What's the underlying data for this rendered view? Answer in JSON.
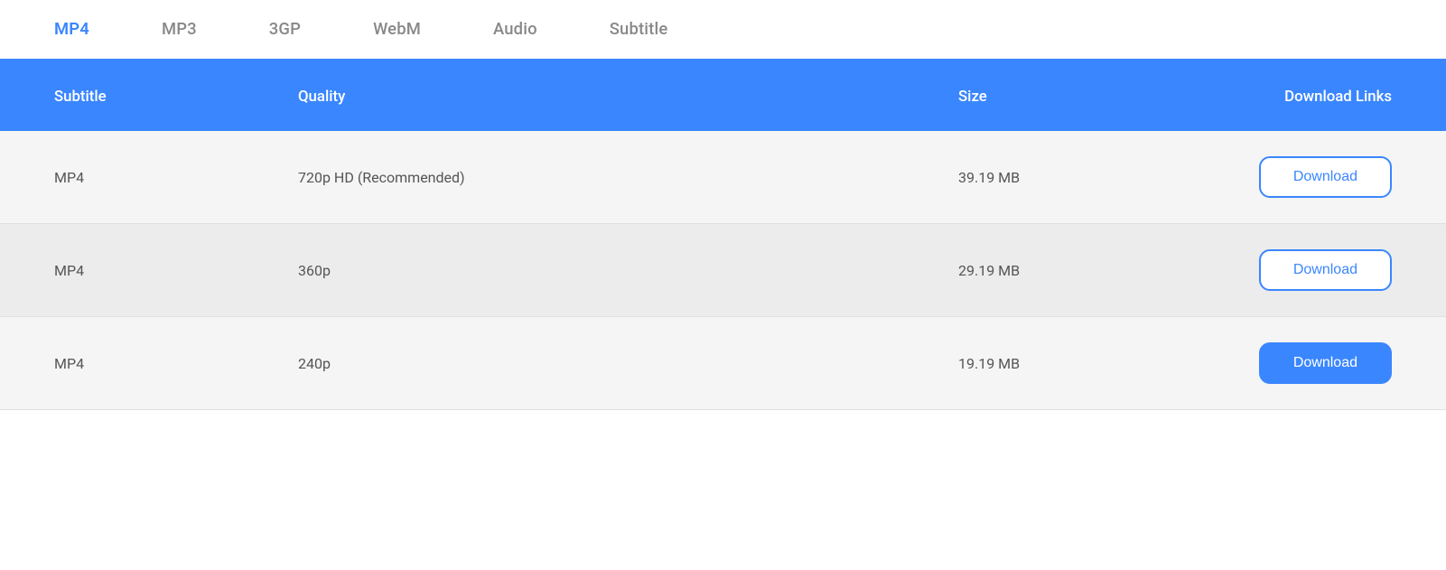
{
  "tabs": [
    {
      "id": "mp4",
      "label": "MP4",
      "active": true
    },
    {
      "id": "mp3",
      "label": "MP3",
      "active": false
    },
    {
      "id": "3gp",
      "label": "3GP",
      "active": false
    },
    {
      "id": "webm",
      "label": "WebM",
      "active": false
    },
    {
      "id": "audio",
      "label": "Audio",
      "active": false
    },
    {
      "id": "subtitle",
      "label": "Subtitle",
      "active": false
    }
  ],
  "table": {
    "headers": {
      "subtitle": "Subtitle",
      "quality": "Quality",
      "size": "Size",
      "download_links": "Download Links"
    },
    "rows": [
      {
        "subtitle": "MP4",
        "quality": "720p HD (Recommended)",
        "size": "39.19 MB",
        "download_label": "Download",
        "btn_style": "outline"
      },
      {
        "subtitle": "MP4",
        "quality": "360p",
        "size": "29.19 MB",
        "download_label": "Download",
        "btn_style": "outline"
      },
      {
        "subtitle": "MP4",
        "quality": "240p",
        "size": "19.19 MB",
        "download_label": "Download",
        "btn_style": "filled"
      }
    ]
  },
  "colors": {
    "accent": "#3a86ff"
  }
}
